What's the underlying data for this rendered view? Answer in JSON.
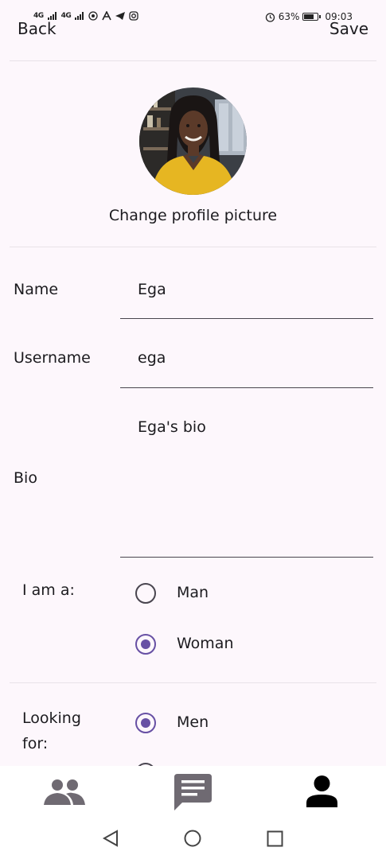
{
  "status_bar": {
    "signal_1": "4G",
    "signal_2": "4G",
    "icons": [
      "hotspot-icon",
      "a-icon",
      "telegram-icon",
      "instagram-icon"
    ],
    "alarm_icon": "alarm-icon",
    "battery_percent": "63%",
    "battery_level": 0.63,
    "time": "09:03"
  },
  "header": {
    "back_label": "Back",
    "save_label": "Save"
  },
  "profile": {
    "change_picture_label": "Change profile picture"
  },
  "form": {
    "name_label": "Name",
    "name_value": "Ega",
    "username_label": "Username",
    "username_value": "ega",
    "bio_label": "Bio",
    "bio_value": "Ega's bio",
    "gender_label": "I am a:",
    "gender_options": [
      {
        "label": "Man",
        "selected": false
      },
      {
        "label": "Woman",
        "selected": true
      }
    ],
    "looking_for_label_line1": "Looking",
    "looking_for_label_line2": "for:",
    "looking_for_options": [
      {
        "label": "Men",
        "selected": true
      }
    ]
  },
  "bottom_nav": {
    "items": [
      "people-icon",
      "chat-icon",
      "person-icon"
    ],
    "active": "person-icon"
  },
  "system_nav": {
    "buttons": [
      "back-triangle-icon",
      "home-circle-icon",
      "recents-square-icon"
    ]
  },
  "colors": {
    "background": "#fdf7fc",
    "accent": "#6750a4",
    "text": "#1c1b1f",
    "inactive_icon": "#6f6a72"
  }
}
